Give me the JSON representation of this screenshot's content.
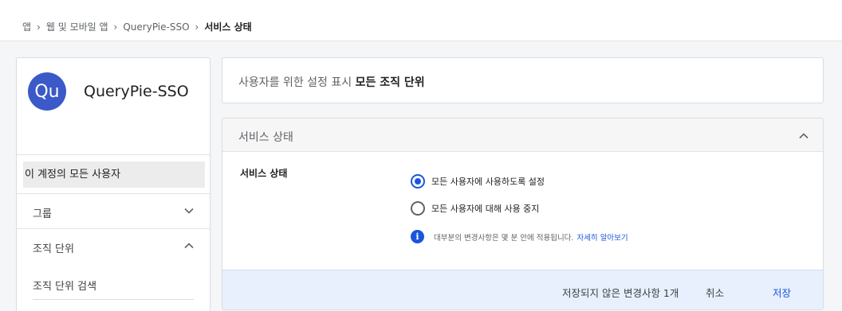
{
  "breadcrumb": {
    "items": [
      "앱",
      "웹 및 모바일 앱",
      "QueryPie-SSO"
    ],
    "current": "서비스 상태",
    "separator": "›"
  },
  "app": {
    "avatar_text": "Qu",
    "name": "QueryPie-SSO",
    "avatar_color": "#3b59c8"
  },
  "sidebar": {
    "all_users": "이 계정의 모든 사용자",
    "groups": "그룹",
    "org_units": "조직 단위",
    "org_search_placeholder": "조직 단위 검색"
  },
  "settings_for": {
    "prefix": "사용자를 위한 설정 표시",
    "scope": "모든 조직 단위"
  },
  "service_status": {
    "section_title": "서비스 상태",
    "label": "서비스 상태",
    "options": [
      "모든 사용자에 사용하도록 설정",
      "모든 사용자에 대해 사용 중지"
    ],
    "selected_index": 0,
    "info_text": "대부분의 변경사항은 몇 분 안에 적용됩니다.",
    "learn_more": "자세히 알아보기"
  },
  "footer": {
    "unsaved": "저장되지 않은 변경사항 1개",
    "cancel": "취소",
    "save": "저장"
  },
  "colors": {
    "accent": "#1a56db",
    "footer_bg": "#e8f0fe"
  }
}
